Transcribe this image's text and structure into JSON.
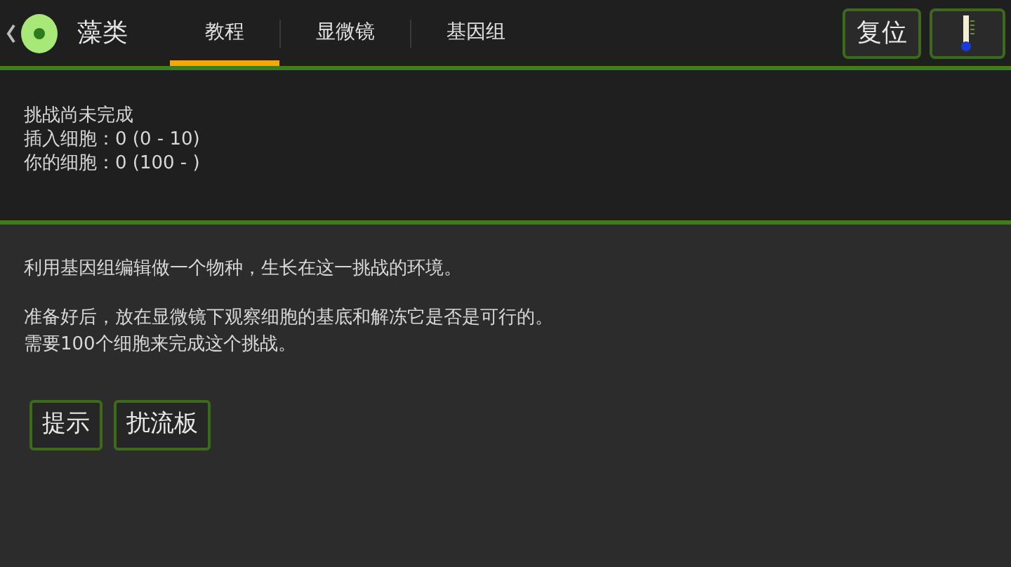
{
  "header": {
    "title": "藻类"
  },
  "tabs": [
    {
      "label": "教程",
      "selected": true
    },
    {
      "label": "显微镜",
      "selected": false
    },
    {
      "label": "基因组",
      "selected": false
    }
  ],
  "toolbar": {
    "reset_button": "复位"
  },
  "status": [
    "挑战尚未完成",
    "插入细胞：0 (0 - 10)",
    "你的细胞：0 (100 - )"
  ],
  "description": [
    [
      "利用基因组编辑做一个物种，生长在这一挑战的环境。"
    ],
    [
      "准备好后，放在显微镜下观察细胞的基底和解冻它是否是可行的。",
      "需要100个细胞来完成这个挑战。"
    ]
  ],
  "buttons": [
    "提示",
    "扰流板"
  ]
}
